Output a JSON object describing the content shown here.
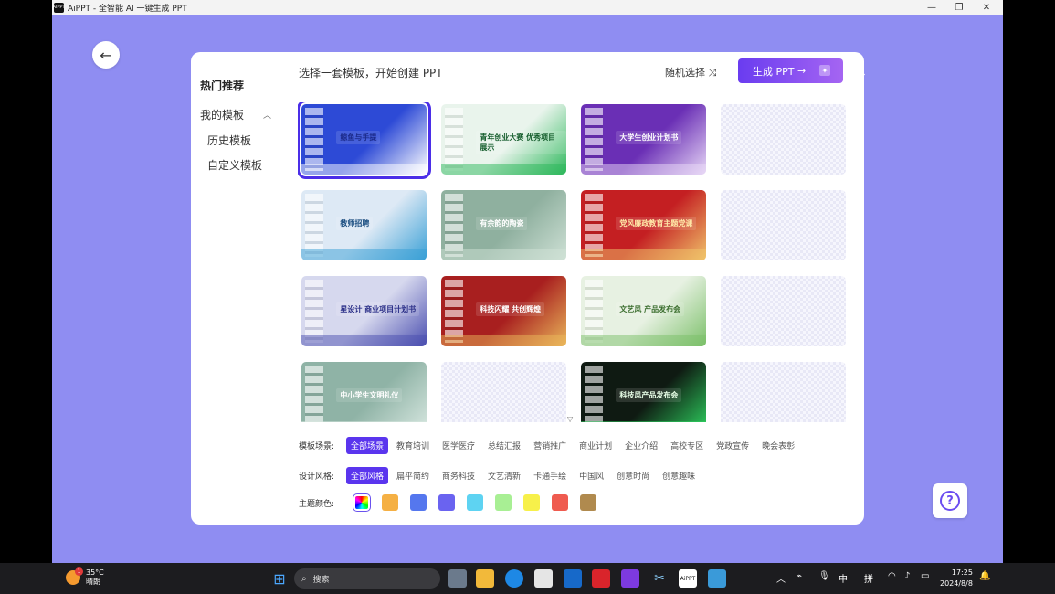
{
  "window": {
    "title": "AiPPT - 全智能 AI 一键生成 PPT",
    "app_icon_text": "AiPPT"
  },
  "sidebar": {
    "hot": "热门推荐",
    "my_templates": "我的模板",
    "history": "历史模板",
    "custom": "自定义模板"
  },
  "header": {
    "title": "选择一套模板，开始创建 PPT",
    "random_label": "随机选择",
    "random_icon": "shuffle-icon",
    "generate_label": "生成 PPT"
  },
  "templates": [
    {
      "title": "鲸鱼与手提",
      "bg": "#2d4ad6",
      "accent": "#ffffff",
      "ink": "#1b2a8a"
    },
    {
      "title": "青年创业大赛 优秀项目展示",
      "bg": "#e9f4ec",
      "accent": "#2eb85c",
      "ink": "#135c2b"
    },
    {
      "title": "大学生创业计划书",
      "bg": "#6a2fb5",
      "accent": "#e7d7f6",
      "ink": "#ffffff"
    },
    {
      "title": "",
      "bg": "",
      "accent": "",
      "ink": ""
    },
    {
      "title": "教师招聘",
      "bg": "#dde9f5",
      "accent": "#3aa0d6",
      "ink": "#1a4d80"
    },
    {
      "title": "有余韵的陶瓷",
      "bg": "#8fb09f",
      "accent": "#cfe1d6",
      "ink": "#ffffff"
    },
    {
      "title": "党风廉政教育主题党课",
      "bg": "#c41f22",
      "accent": "#f0c36a",
      "ink": "#ffe9a8"
    },
    {
      "title": "",
      "bg": "",
      "accent": "",
      "ink": ""
    },
    {
      "title": "星设计 商业项目计划书",
      "bg": "#d6d8ee",
      "accent": "#4b4fb0",
      "ink": "#2b2f88"
    },
    {
      "title": "科技闪耀 共创辉煌",
      "bg": "#a81f1f",
      "accent": "#e9b65a",
      "ink": "#ffffff"
    },
    {
      "title": "文艺风 产品发布会",
      "bg": "#e7f1e2",
      "accent": "#7cc06a",
      "ink": "#3b6e2e"
    },
    {
      "title": "",
      "bg": "",
      "accent": "",
      "ink": ""
    },
    {
      "title": "中小学生文明礼仪",
      "bg": "#8fb3a6",
      "accent": "#d7e7e0",
      "ink": "#ffffff"
    },
    {
      "title": "",
      "bg": "",
      "accent": "",
      "ink": ""
    },
    {
      "title": "科技风产品发布会",
      "bg": "#0f1a12",
      "accent": "#2ed15f",
      "ink": "#e8ffe8"
    },
    {
      "title": "",
      "bg": "",
      "accent": "",
      "ink": ""
    }
  ],
  "filters": {
    "scene_label": "模板场景:",
    "scenes": [
      "全部场景",
      "教育培训",
      "医学医疗",
      "总结汇报",
      "营销推广",
      "商业计划",
      "企业介绍",
      "高校专区",
      "党政宣传",
      "晚会表彰"
    ],
    "style_label": "设计风格:",
    "styles": [
      "全部风格",
      "扁平简约",
      "商务科技",
      "文艺清新",
      "卡通手绘",
      "中国风",
      "创意时尚",
      "创意趣味"
    ],
    "color_label": "主题颜色:",
    "colors": [
      "all",
      "#f5b044",
      "#5577ee",
      "#6a63f0",
      "#5ed3f2",
      "#a8ef94",
      "#f7f04a",
      "#ef5b4f",
      "#b08a4e"
    ]
  },
  "help": {
    "icon": "question-icon",
    "glyph": "?"
  },
  "taskbar": {
    "weather_temp": "35°C",
    "weather_desc": "晴朗",
    "weather_badge": "1",
    "search_placeholder": "搜索",
    "ime1": "中",
    "ime2": "拼",
    "time": "17:25",
    "date": "2024/8/8"
  }
}
